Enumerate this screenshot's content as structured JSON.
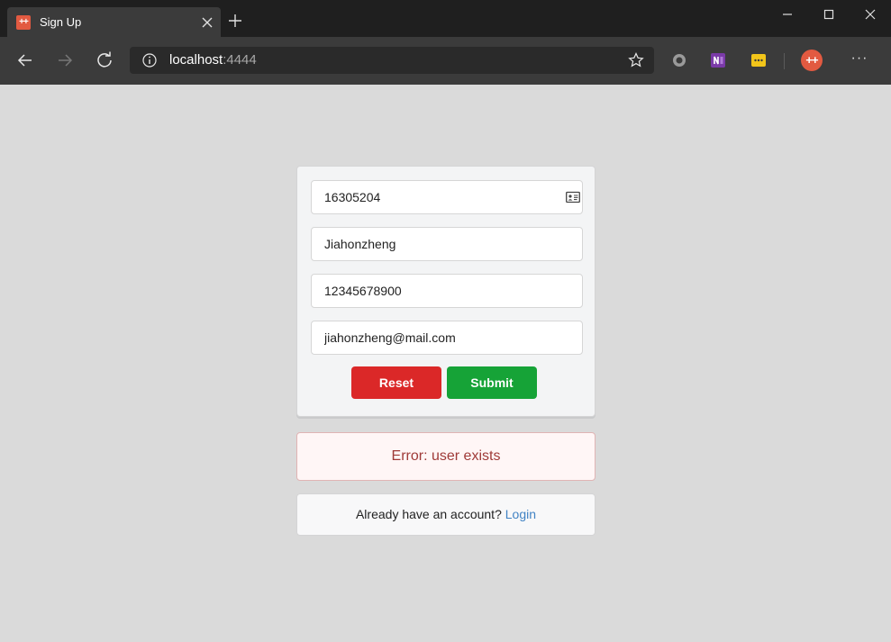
{
  "browser": {
    "tab_title": "Sign Up",
    "favicon_text": "++",
    "url_host": "localhost",
    "url_port": ":4444",
    "profile_text": "++",
    "more_text": "···"
  },
  "form": {
    "student_id": "16305204",
    "username": "Jiahonzheng",
    "phone": "12345678900",
    "email": "jiahonzheng@mail.com",
    "reset_label": "Reset",
    "submit_label": "Submit"
  },
  "error": {
    "message": "Error: user exists"
  },
  "footer": {
    "prompt": "Already have an account? ",
    "login_link": "Login"
  },
  "colors": {
    "reset": "#db2828",
    "submit": "#16a337",
    "error_text": "#9f3a38",
    "link": "#4183c4"
  }
}
